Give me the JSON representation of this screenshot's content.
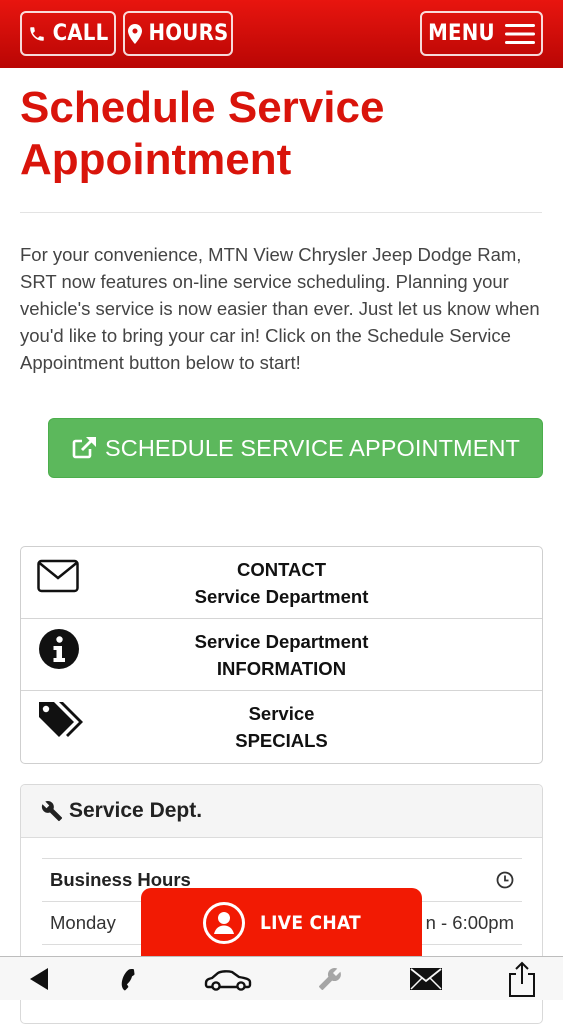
{
  "header": {
    "call_label": "CALL",
    "hours_label": "HOURS",
    "menu_label": "MENU",
    "bar_color": "#d40c08"
  },
  "main": {
    "title_line1": "Schedule Service",
    "title_line2": "Appointment",
    "title_color": "#d9140b",
    "intro": "For your convenience, MTN View Chrysler Jeep Dodge Ram, SRT now features on-line service scheduling. Planning your vehicle's service is now easier than ever. Just let us know when you'd like to bring your car in! Click on the Schedule Service Appointment button below to start!",
    "schedule_button": "SCHEDULE SERVICE APPOINTMENT",
    "schedule_button_color": "#5cb85c"
  },
  "links": [
    {
      "line1": "CONTACT",
      "line2": "Service Department",
      "icon": "envelope-icon"
    },
    {
      "line1": "Service Department",
      "line2": "INFORMATION",
      "icon": "info-circle-icon"
    },
    {
      "line1": "Service",
      "line2": "SPECIALS",
      "icon": "tags-icon"
    }
  ],
  "service_panel": {
    "title": "Service Dept.",
    "hours_header": "Business Hours",
    "rows": [
      {
        "day": "Monday",
        "hours": "n - 6:00pm"
      }
    ]
  },
  "live_chat": {
    "label": "LIVE CHAT",
    "color": "#f21a03"
  },
  "toolbar": {
    "icons": [
      "back-arrow-icon",
      "phone-icon",
      "car-icon",
      "wrench-icon",
      "mail-icon",
      "share-icon"
    ]
  }
}
